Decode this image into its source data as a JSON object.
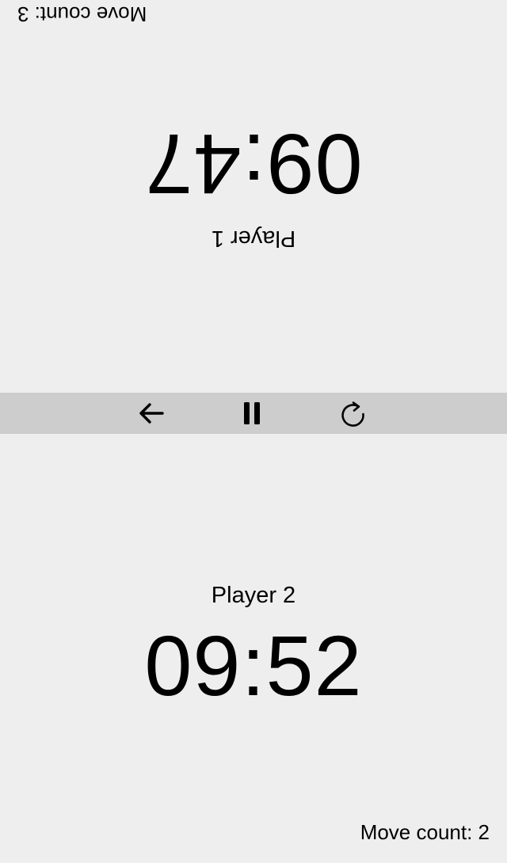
{
  "player1": {
    "name": "Player 1",
    "time": "09:47",
    "move_count": "Move count: 3"
  },
  "player2": {
    "name": "Player 2",
    "time": "09:52",
    "move_count": "Move count: 2"
  },
  "toolbar": {
    "icons": [
      "arrow-left-icon",
      "pause-icon",
      "reset-icon"
    ]
  },
  "colors": {
    "background": "#eeeeee",
    "toolbar": "#cdcdcd",
    "text": "#000000"
  }
}
